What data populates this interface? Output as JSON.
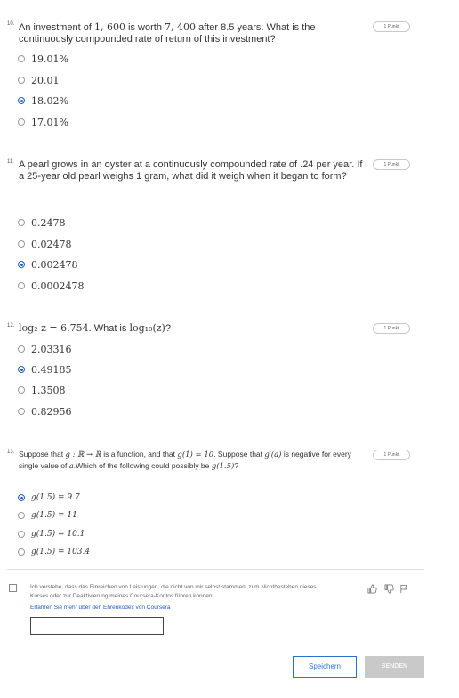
{
  "questions": [
    {
      "number": "10.",
      "text_pre": "An investment of ",
      "m1": "1, 600",
      "text_mid": " is worth ",
      "m2": "7, 400",
      "text_post": " after 8.5 years. What is the continuously compounded rate of return of this investment?",
      "points": "1 Punkt",
      "options": [
        "19.01%",
        "20.01",
        "18.02%",
        "17.01%"
      ],
      "selected_index": 2
    },
    {
      "number": "11.",
      "text": "A pearl grows in an oyster at a continuously compounded rate of .24 per year. If a 25-year old pearl weighs 1 gram, what did it weigh when it began to form?",
      "points": "1 Punkt",
      "options": [
        "0.2478",
        "0.02478",
        "0.002478",
        "0.0002478"
      ],
      "selected_index": 2
    },
    {
      "number": "12.",
      "math_pre": "log₂ z = 6.754",
      "text_mid": ". What is ",
      "math_post": "log₁₀(z)",
      "text_end": "?",
      "points": "1 Punkt",
      "options": [
        "2.03316",
        "0.49185",
        "1.3508",
        "0.82956"
      ],
      "selected_index": 1
    },
    {
      "number": "13.",
      "text_a": "Suppose that ",
      "m_a": "g : ℝ → ℝ",
      "text_b": " is a function, and that ",
      "m_b": "g(1) = 10",
      "text_c": ". Suppose that ",
      "m_c": "g′(a)",
      "text_d": " is negative for every single value of ",
      "m_d": "a",
      "text_e": ".Which of the following could possibly be ",
      "m_e": "g(1.5)",
      "text_f": "?",
      "points": "1 Punkt",
      "options": [
        "g(1.5) = 9.7",
        "g(1.5) = 11",
        "g(1.5) = 10.1",
        "g(1.5) = 103.4"
      ],
      "selected_index": 0
    }
  ],
  "honor": {
    "text": "Ich verstehe, dass das Einreichen von Leistungen, die nicht von mir selbst stammen, zum Nichtbestehen dieses Kurses oder zur Deaktivierung meines Coursera-Kontos führen können.",
    "link": "Erfahren Sie mehr über den Ehrenkodex von Coursera",
    "name_value": ""
  },
  "feedback_icons": [
    "thumbs-up-icon",
    "thumbs-down-icon",
    "flag-icon"
  ],
  "buttons": {
    "save": "Speichern",
    "submit": "SENDEN"
  },
  "colors": {
    "accent": "#2a73cc",
    "radio_selected": "#1f5fbf",
    "submit_disabled_bg": "#c9c9c9"
  }
}
